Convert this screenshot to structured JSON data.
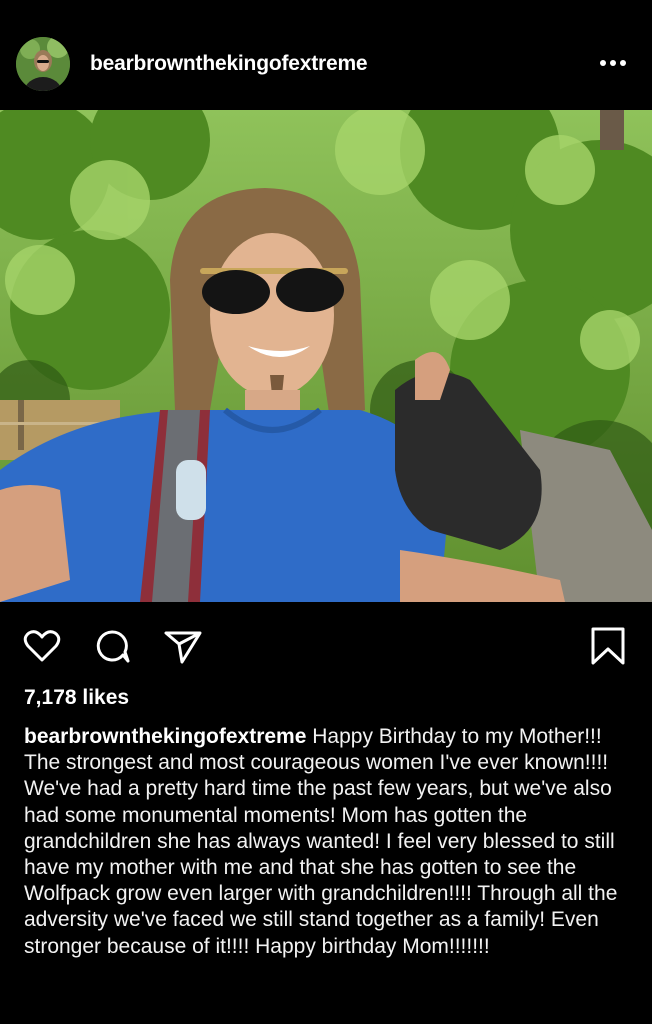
{
  "post": {
    "username": "bearbrownthekingofextreme",
    "more_icon": "more-options-icon",
    "likes": "7,178 likes",
    "caption": "Happy Birthday to my Mother!!! The strongest and most courageous women I've ever known!!!! We've had a pretty hard time the past few years, but we've also had some monumental moments! Mom has gotten the grandchildren she has always wanted! I feel very blessed to still have my mother with me and that she has gotten to see the Wolfpack grow even larger with grandchildren!!!! Through all the adversity we've faced we still stand together as a family! Even stronger because of it!!!! Happy birthday Mom!!!!!!!"
  },
  "actions": {
    "like_icon": "heart-icon",
    "comment_icon": "comment-icon",
    "share_icon": "send-icon",
    "save_icon": "bookmark-icon"
  },
  "colors": {
    "background": "#000000",
    "text": "#ffffff"
  }
}
